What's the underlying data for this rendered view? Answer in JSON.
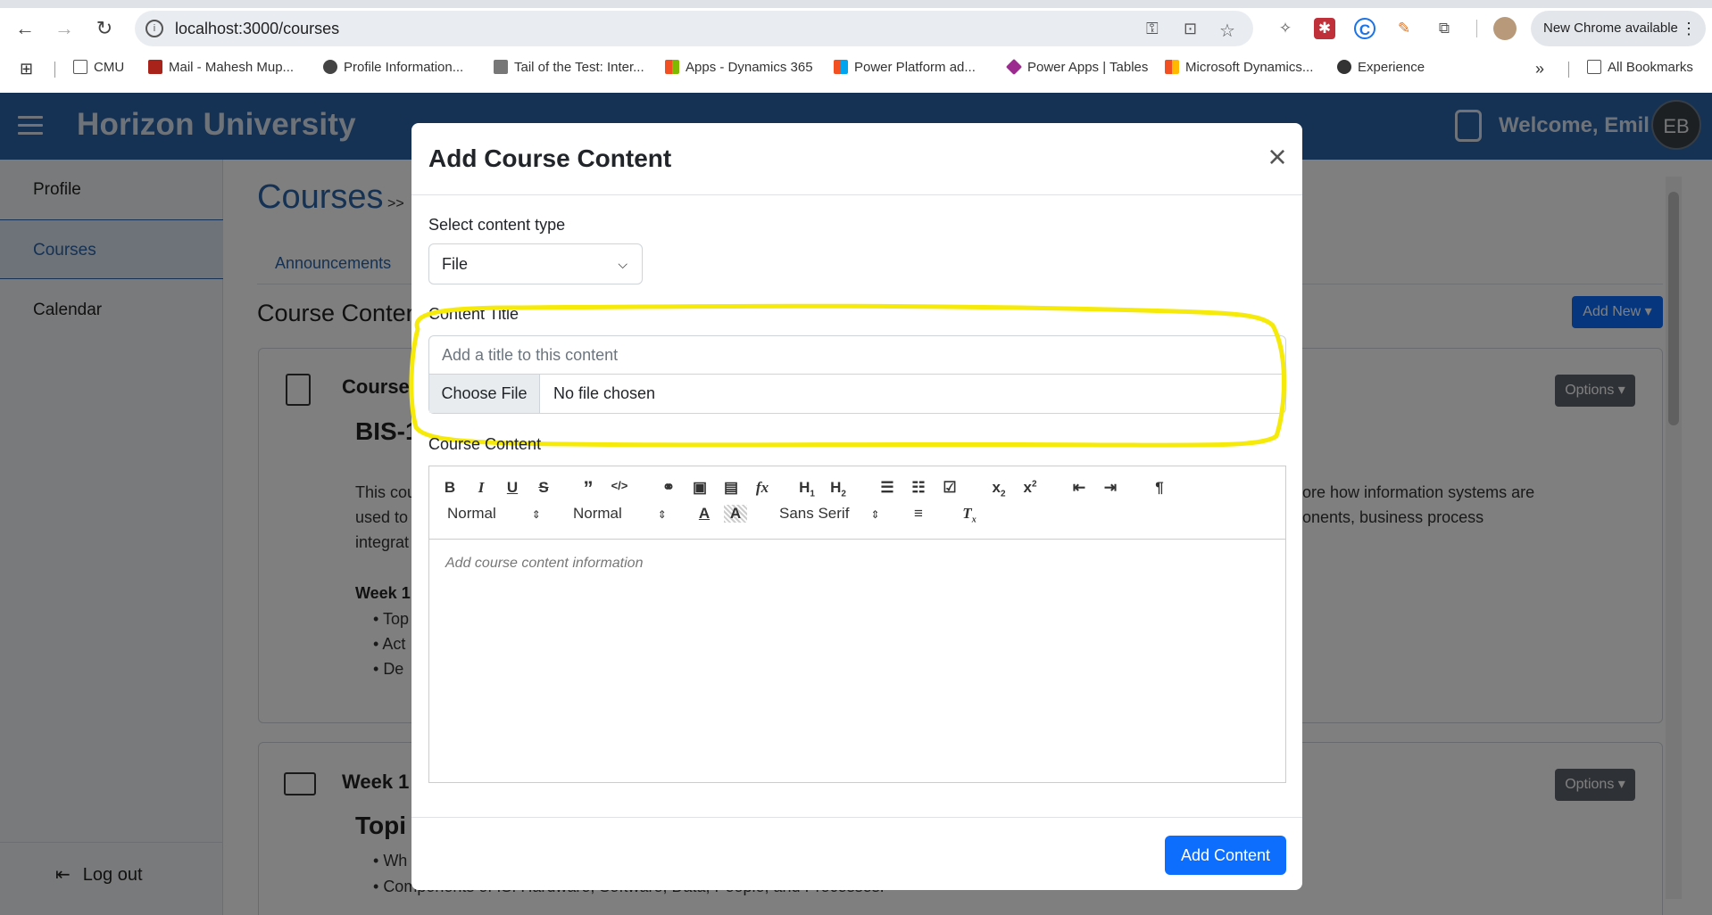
{
  "browser": {
    "url": "localhost:3000/courses",
    "new_chrome": "New Chrome available",
    "bookmarks": [
      {
        "label": "CMU",
        "icon": "folder-icon"
      },
      {
        "label": "Mail - Mahesh Mup...",
        "icon": "mail-icon"
      },
      {
        "label": "Profile Information...",
        "icon": "apple-icon"
      },
      {
        "label": "Tail of the Test: Inter...",
        "icon": "bird-icon"
      },
      {
        "label": "Apps - Dynamics 365",
        "icon": "microsoft-icon"
      },
      {
        "label": "Power Platform ad...",
        "icon": "microsoft-icon"
      },
      {
        "label": "Power Apps | Tables",
        "icon": "powerapps-icon"
      },
      {
        "label": "Microsoft Dynamics...",
        "icon": "microsoft-icon"
      },
      {
        "label": "Experience",
        "icon": "globe-icon"
      }
    ],
    "all_bookmarks": "All Bookmarks"
  },
  "app": {
    "brand": "Horizon University",
    "welcome": "Welcome, Emil",
    "avatar": "EB",
    "brand_color": "#2b65a8"
  },
  "sidebar": {
    "items": [
      {
        "label": "Profile"
      },
      {
        "label": "Courses"
      },
      {
        "label": "Calendar"
      }
    ],
    "logout": "Log out"
  },
  "background": {
    "page_title": "Courses",
    "crumb_sep": ">>",
    "tab": "Announcements",
    "section": "Course Content",
    "add_new": "Add New",
    "card1_title": "Course",
    "card1_heading": "BIS-1",
    "card1_text_left1": "This cou",
    "card1_text_left2": "used to",
    "card1_text_left3": "integrat",
    "card1_text_right1": "ore how information systems are",
    "card1_text_right2": "onents, business process",
    "week_label": "Week 1",
    "bullets": [
      "Top",
      "Act",
      "De"
    ],
    "options": "Options",
    "card2_title": "Week 1",
    "card2_heading": "Topi",
    "card2_bullets": [
      "Wh",
      "Components of IS: Hardware, Software, Data, People, and Processes."
    ]
  },
  "modal": {
    "title": "Add Course Content",
    "close": "×",
    "type_label": "Select content type",
    "type_value": "File",
    "content_title_label": "Content Title",
    "title_placeholder": "Add a title to this content",
    "choose_file": "Choose File",
    "no_file": "No file chosen",
    "course_content_label": "Course Content",
    "toolbar": {
      "header_size": "Normal",
      "text_size": "Normal",
      "font": "Sans Serif"
    },
    "editor_placeholder": "Add course content information",
    "submit": "Add Content",
    "highlight_color": "#f5ea0a"
  }
}
